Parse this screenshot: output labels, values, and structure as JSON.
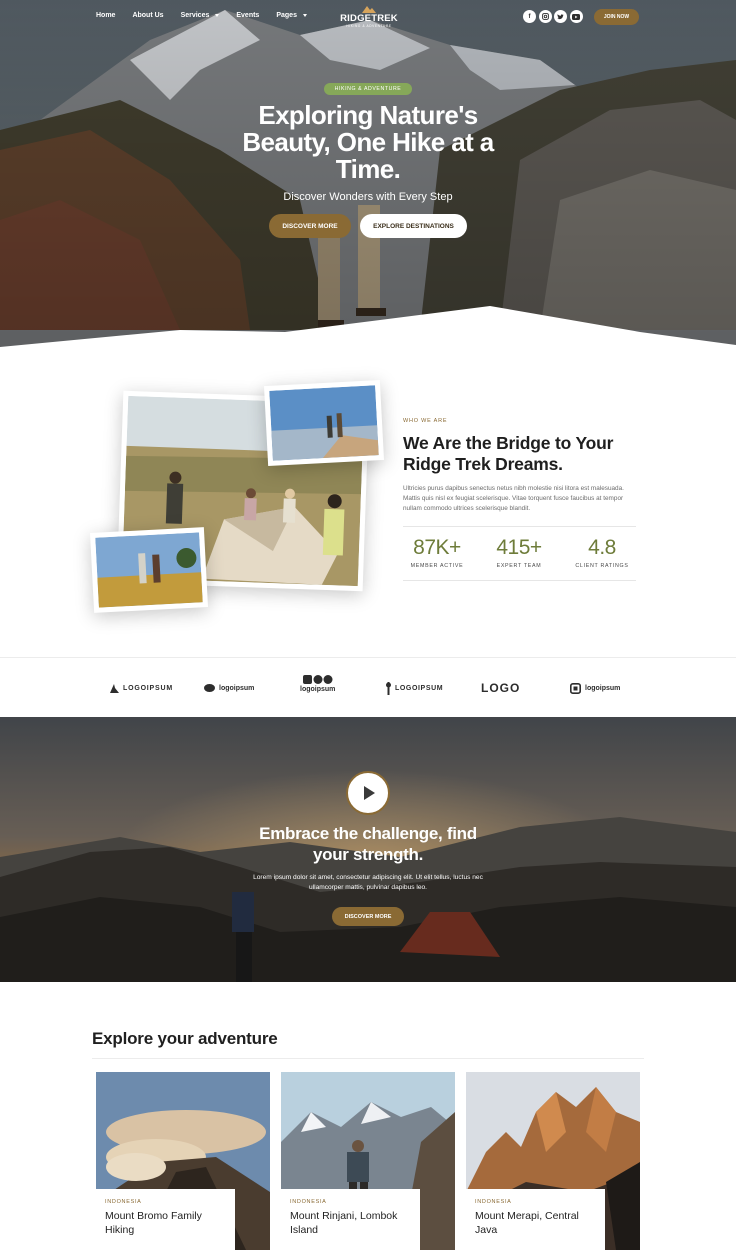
{
  "nav": {
    "links": [
      {
        "label": "Home",
        "dropdown": false
      },
      {
        "label": "About Us",
        "dropdown": false
      },
      {
        "label": "Services",
        "dropdown": true
      },
      {
        "label": "Events",
        "dropdown": false
      },
      {
        "label": "Pages",
        "dropdown": true
      }
    ],
    "logo_name": "RIDGETREK",
    "logo_tagline": "HIKING & ADVENTURE",
    "socials": [
      "facebook-icon",
      "instagram-icon",
      "twitter-icon",
      "youtube-icon"
    ],
    "join_label": "JOIN NOW"
  },
  "hero": {
    "badge": "HIKING & ADVENTURE",
    "title": "Exploring Nature's Beauty, One Hike at a Time.",
    "subtitle": "Discover Wonders with Every Step",
    "primary_btn": "DISCOVER MORE",
    "secondary_btn": "EXPLORE DESTINATIONS"
  },
  "about": {
    "eyebrow": "WHO WE ARE",
    "title": "We Are the Bridge to Your Ridge Trek Dreams.",
    "text": "Ultricies purus dapibus senectus netus nibh molestie nisi litora est malesuada. Mattis quis nisl ex feugiat scelerisque. Vitae torquent fusce faucibus at tempor nullam commodo ultrices scelerisque blandit.",
    "stats": [
      {
        "value": "87K+",
        "label": "MEMBER ACTIVE"
      },
      {
        "value": "415+",
        "label": "EXPERT TEAM"
      },
      {
        "value": "4.8",
        "label": "CLIENT RATINGS"
      }
    ]
  },
  "logos": [
    "LOGOIPSUM",
    "logoipsum",
    "logoipsum",
    "LOGOIPSUM",
    "LOGO",
    "logoipsum"
  ],
  "challenge": {
    "title": "Embrace the challenge, find your strength.",
    "text": "Lorem ipsum dolor sit amet, consectetur adipiscing elit. Ut elit tellus, luctus nec ullamcorper mattis, pulvinar dapibus leo.",
    "button": "DISCOVER MORE"
  },
  "explore": {
    "title": "Explore your adventure",
    "cards": [
      {
        "country": "INDONESIA",
        "name": "Mount Bromo Family Hiking"
      },
      {
        "country": "INDONESIA",
        "name": "Mount Rinjani, Lombok Island"
      },
      {
        "country": "INDONESIA",
        "name": "Mount Merapi, Central Java"
      }
    ]
  },
  "colors": {
    "accent": "#8a6a34",
    "badge_green": "#86a859",
    "stat_green": "#6e7c3a"
  }
}
